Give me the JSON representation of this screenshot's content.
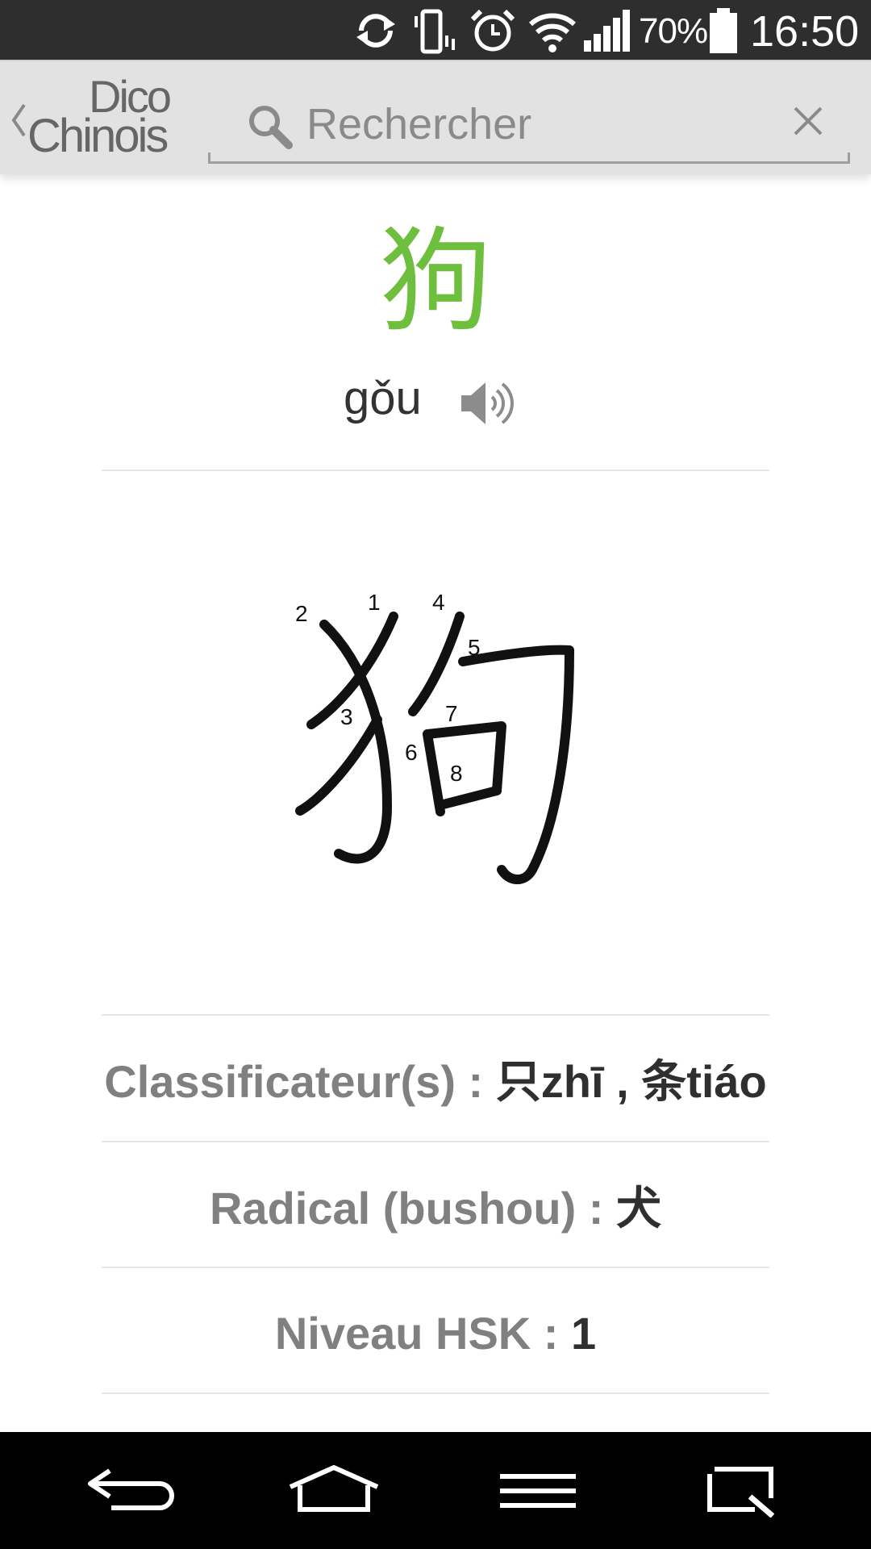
{
  "status_bar": {
    "battery_percent": "70%",
    "time": "16:50",
    "icons": [
      "sync-icon",
      "vibrate-icon",
      "alarm-icon",
      "wifi-icon",
      "signal-icon",
      "battery-icon"
    ]
  },
  "app_bar": {
    "logo_line1": "Dico",
    "logo_line2": "Chinois",
    "search_placeholder": "Rechercher",
    "icons": [
      "back-chevron-icon",
      "search-icon",
      "close-icon"
    ]
  },
  "entry": {
    "character": "狗",
    "pinyin": "gǒu",
    "stroke_numbers": [
      "1",
      "2",
      "3",
      "4",
      "5",
      "6",
      "7",
      "8"
    ],
    "classifiers": {
      "label": "Classificateur(s) :",
      "value": "只zhī , 条tiáo"
    },
    "radical": {
      "label": "Radical (bushou) :",
      "value": "犬"
    },
    "hsk": {
      "label": "Niveau HSK :",
      "value": "1"
    }
  },
  "colors": {
    "accent_green": "#6fbf3e",
    "status_bar": "#2e2e2e",
    "app_bar": "#e2e2e2",
    "label_gray": "#808080",
    "nav_bar": "#000000"
  },
  "nav_bar": {
    "icons": [
      "back-icon",
      "home-icon",
      "menu-icon",
      "recent-apps-icon"
    ]
  }
}
